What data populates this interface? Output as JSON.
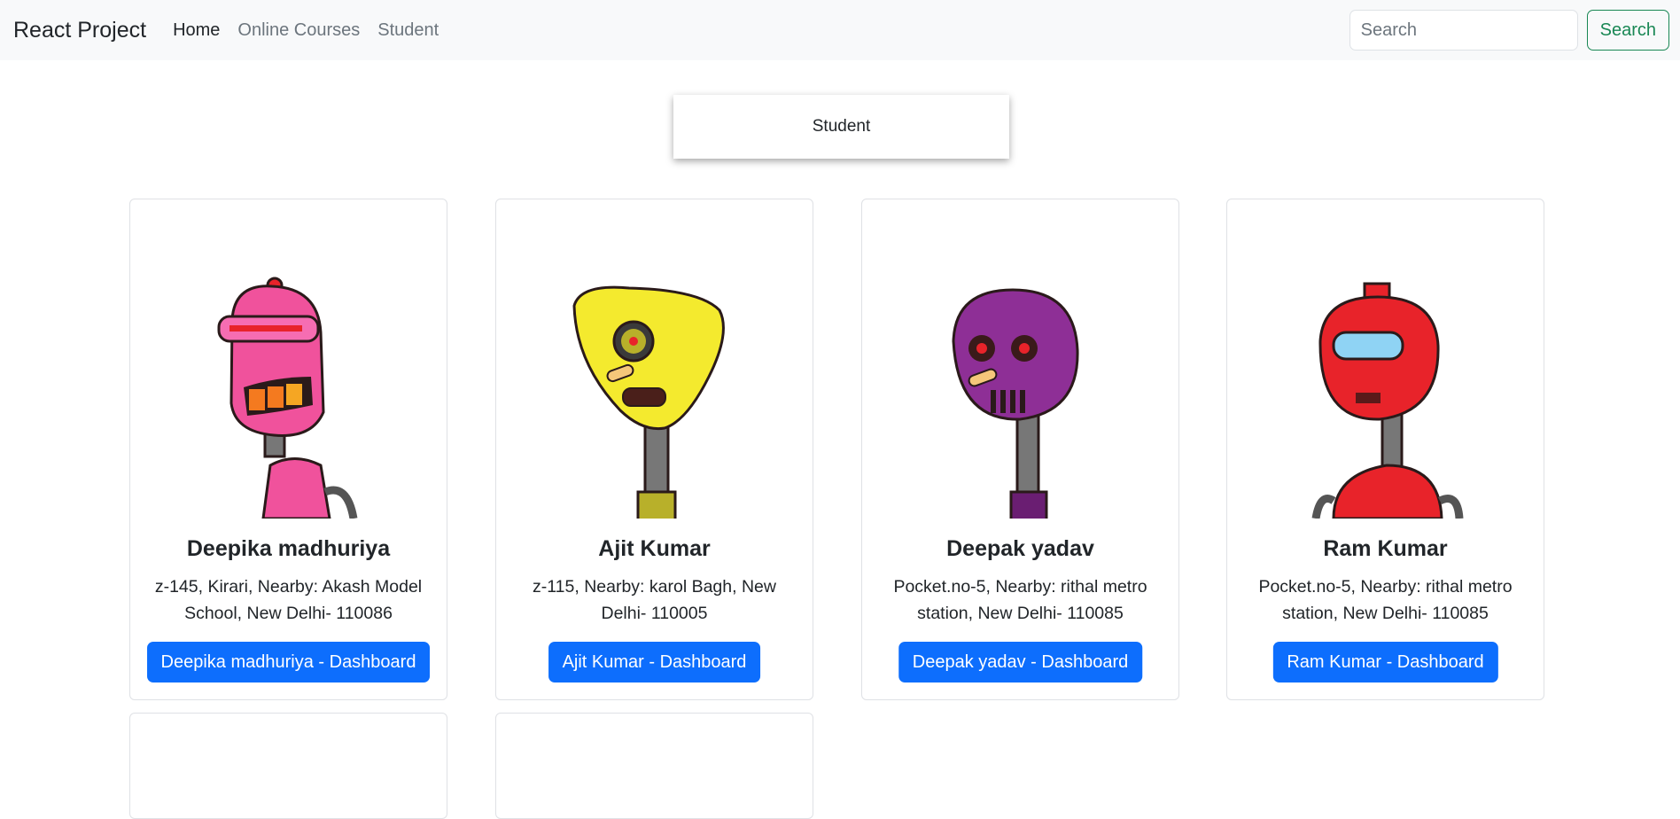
{
  "navbar": {
    "brand": "React Project",
    "links": [
      {
        "label": "Home"
      },
      {
        "label": "Online Courses"
      },
      {
        "label": "Student"
      }
    ],
    "search_placeholder": "Search",
    "search_button": "Search"
  },
  "page": {
    "heading": "Student"
  },
  "students": [
    {
      "name": "Deepika madhuriya",
      "address": "z-145, Kirari, Nearby: Akash Model School, New Delhi- 110086",
      "button": "Deepika madhuriya - Dashboard",
      "avatar_icon": "pink-robot-avatar",
      "color": "#f0529c"
    },
    {
      "name": "Ajit Kumar",
      "address": "z-115, Nearby: karol Bagh, New Delhi- 110005",
      "button": "Ajit Kumar - Dashboard",
      "avatar_icon": "yellow-robot-avatar",
      "color": "#f4ea2e"
    },
    {
      "name": "Deepak yadav",
      "address": "Pocket.no-5, Nearby: rithal metro station, New Delhi- 110085",
      "button": "Deepak yadav - Dashboard",
      "avatar_icon": "purple-robot-avatar",
      "color": "#8e2f96"
    },
    {
      "name": "Ram Kumar",
      "address": "Pocket.no-5, Nearby: rithal metro station, New Delhi- 110085",
      "button": "Ram Kumar - Dashboard",
      "avatar_icon": "red-robot-avatar",
      "color": "#e8232a"
    }
  ],
  "colors": {
    "primary": "#0d6efd",
    "success": "#198754",
    "navbar_bg": "#f8f9fa"
  }
}
